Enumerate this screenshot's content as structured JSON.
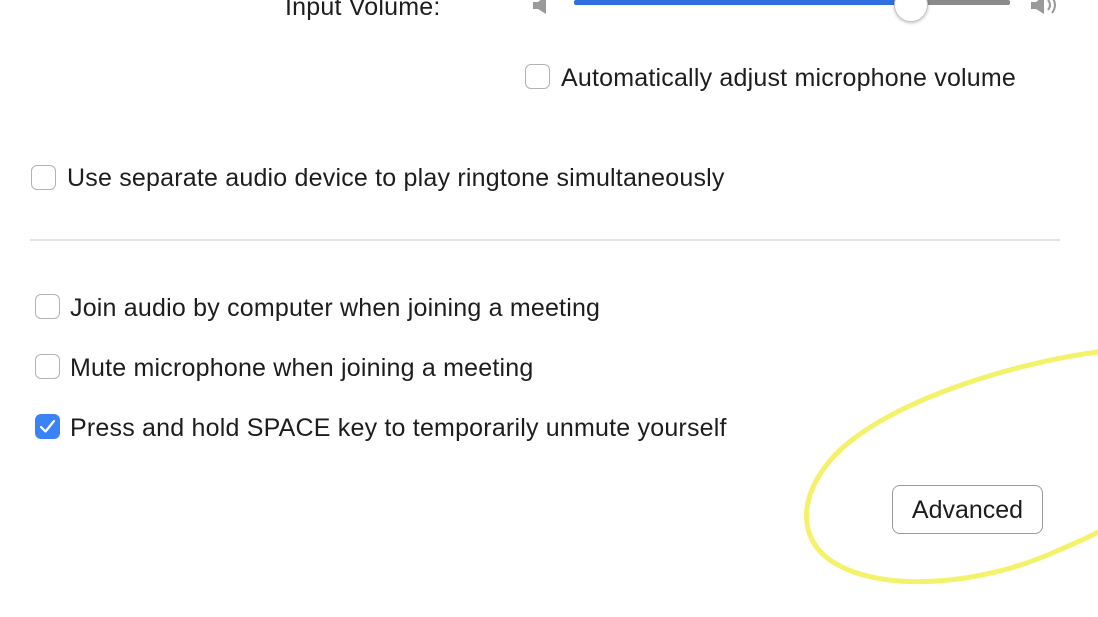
{
  "input_volume": {
    "label": "Input Volume:",
    "level_fraction": 0.77
  },
  "auto_adjust": {
    "label": "Automatically adjust microphone volume",
    "checked": false
  },
  "separate_ringtone": {
    "label": "Use separate audio device to play ringtone simultaneously",
    "checked": false
  },
  "options": [
    {
      "label": "Join audio by computer when joining a meeting",
      "checked": false
    },
    {
      "label": "Mute microphone when joining a meeting",
      "checked": false
    },
    {
      "label": "Press and hold SPACE key to temporarily unmute yourself",
      "checked": true
    }
  ],
  "advanced_button": {
    "label": "Advanced"
  },
  "colors": {
    "accent": "#3b82f6",
    "slider_fill": "#2f6fdf",
    "highlight": "#f4f26a"
  },
  "icons": {
    "volume_low": "speaker-low-icon",
    "volume_high": "speaker-high-icon",
    "checkmark": "checkmark-icon"
  }
}
